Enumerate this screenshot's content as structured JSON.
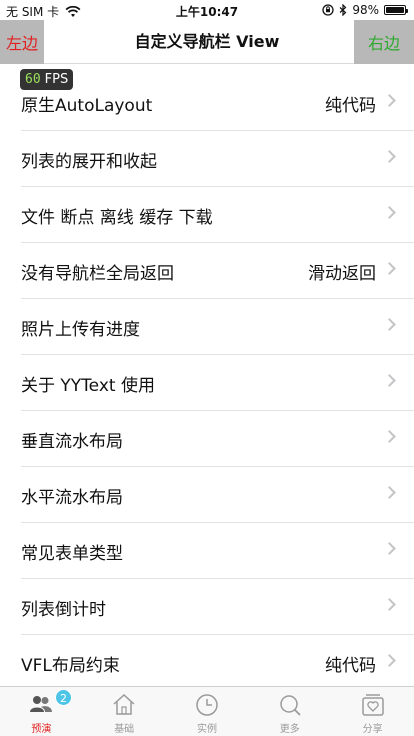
{
  "status_bar": {
    "carrier": "无 SIM 卡",
    "time": "上午10:47",
    "battery": "98%",
    "battery_level": 0.98
  },
  "nav": {
    "left_label": "左边",
    "title": "自定义导航栏 View",
    "right_label": "右边"
  },
  "fps": {
    "value": "60",
    "label": "FPS"
  },
  "list": {
    "rows": [
      {
        "title": "原生AutoLayout",
        "detail": "纯代码"
      },
      {
        "title": "列表的展开和收起",
        "detail": ""
      },
      {
        "title": "文件 断点 离线 缓存 下载",
        "detail": ""
      },
      {
        "title": "没有导航栏全局返回",
        "detail": "滑动返回"
      },
      {
        "title": "照片上传有进度",
        "detail": ""
      },
      {
        "title": "关于 YYText 使用",
        "detail": ""
      },
      {
        "title": "垂直流水布局",
        "detail": ""
      },
      {
        "title": "水平流水布局",
        "detail": ""
      },
      {
        "title": "常见表单类型",
        "detail": ""
      },
      {
        "title": "列表倒计时",
        "detail": ""
      },
      {
        "title": "VFL布局约束",
        "detail": "纯代码"
      }
    ]
  },
  "tab_bar": {
    "tabs": [
      {
        "label": "预演",
        "icon": "people-icon",
        "badge": "2",
        "active": true
      },
      {
        "label": "基础",
        "icon": "home-icon",
        "badge": "",
        "active": false
      },
      {
        "label": "实例",
        "icon": "clock-icon",
        "badge": "",
        "active": false
      },
      {
        "label": "更多",
        "icon": "search-icon",
        "badge": "",
        "active": false
      },
      {
        "label": "分享",
        "icon": "share-heart-icon",
        "badge": "",
        "active": false
      }
    ]
  },
  "colors": {
    "nav_button_bg": "#b8b8b8",
    "left_label": "#e12020",
    "right_label": "#2fa82f",
    "active_tab": "#e12020",
    "badge": "#4ec5e6"
  }
}
